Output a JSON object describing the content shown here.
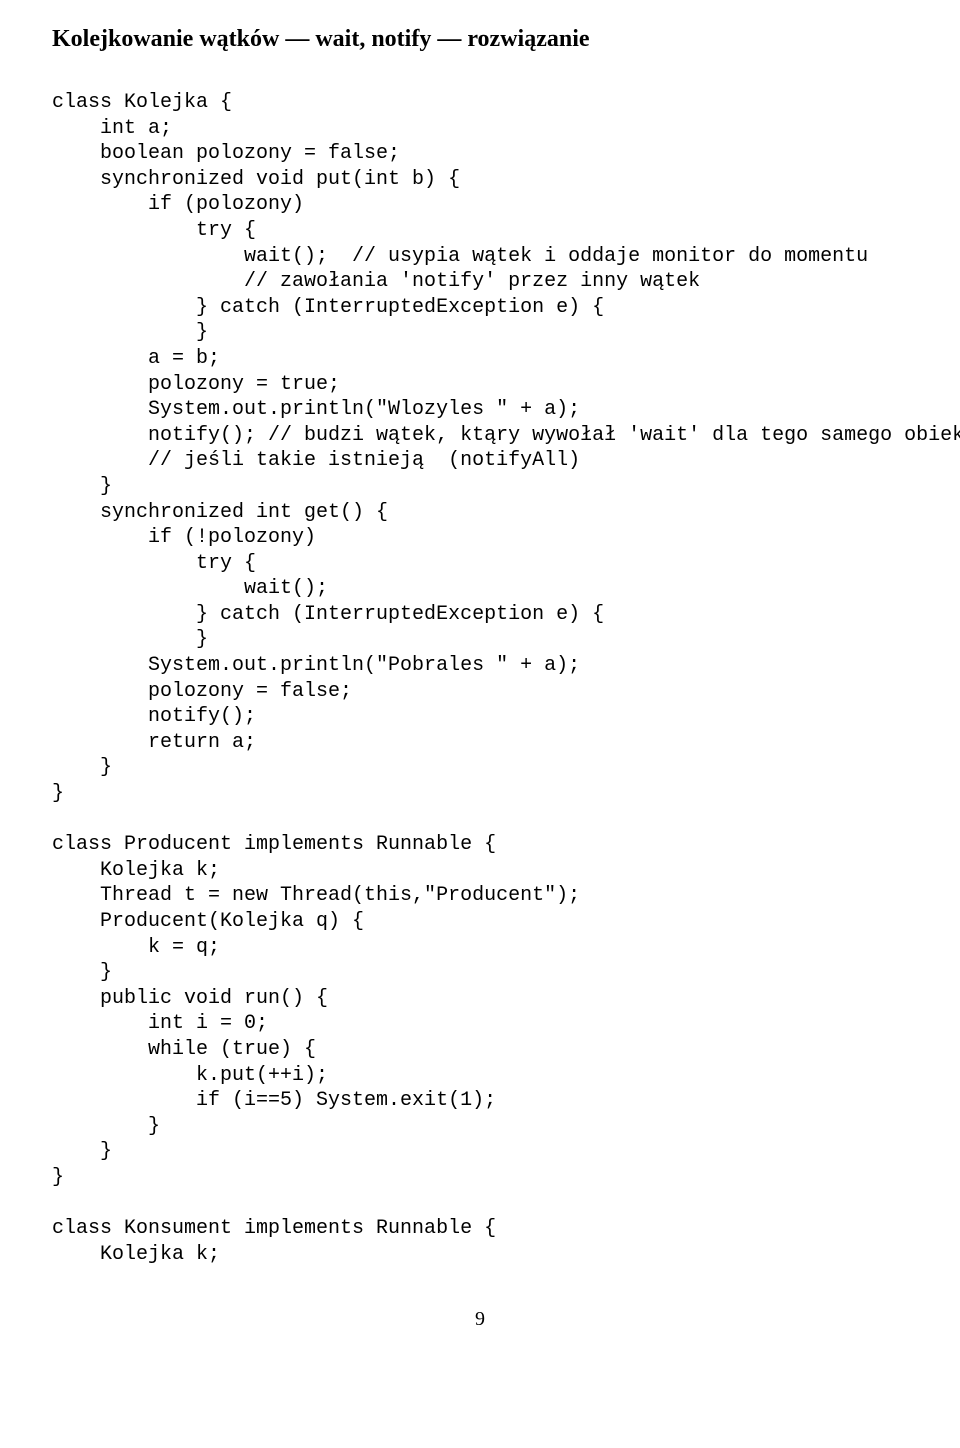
{
  "heading": "Kolejkowanie wątków — wait, notify — rozwiązanie",
  "code": "class Kolejka {\n    int a;\n    boolean polozony = false;\n    synchronized void put(int b) {\n        if (polozony)\n            try {\n                wait();  // usypia wątek i oddaje monitor do momentu\n                // zawołania 'notify' przez inny wątek\n            } catch (InterruptedException e) {\n            }\n        a = b;\n        polozony = true;\n        System.out.println(\"Wlozyles \" + a);\n        notify(); // budzi wątek, ktąry wywołał 'wait' dla tego samego obiektu,\n        // jeśli takie istnieją  (notifyAll)\n    }\n    synchronized int get() {\n        if (!polozony)\n            try {\n                wait();\n            } catch (InterruptedException e) {\n            }\n        System.out.println(\"Pobrales \" + a);\n        polozony = false;\n        notify();\n        return a;\n    }\n}\n\nclass Producent implements Runnable {\n    Kolejka k;\n    Thread t = new Thread(this,\"Producent\");\n    Producent(Kolejka q) {\n        k = q;\n    }\n    public void run() {\n        int i = 0;\n        while (true) {\n            k.put(++i);\n            if (i==5) System.exit(1);\n        }\n    }\n}\n\nclass Konsument implements Runnable {\n    Kolejka k;",
  "pageNumber": "9"
}
